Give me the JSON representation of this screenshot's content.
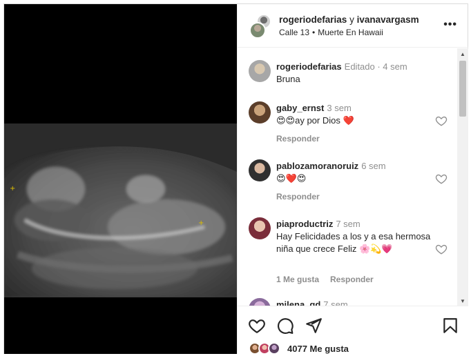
{
  "header": {
    "user1": "rogeriodefarias",
    "conj": "y",
    "user2": "ivanavargasm",
    "artist": "Calle 13",
    "song": "Muerte En Hawaii",
    "more": "•••"
  },
  "comments": [
    {
      "user": "rogeriodefarias",
      "meta": "Editado  ·  4 sem",
      "text": "Bruna",
      "reply": "",
      "likes": ""
    },
    {
      "user": "gaby_ernst",
      "meta": "3 sem",
      "text": "😍😍ay por Dios ❤️",
      "reply": "Responder",
      "likes": ""
    },
    {
      "user": "pablozamoranoruiz",
      "meta": "6 sem",
      "text": "😍❤️😍",
      "reply": "Responder",
      "likes": ""
    },
    {
      "user": "piaproductriz",
      "meta": "7 sem",
      "text": "Hay Felicidades a los y a esa hermosa niña que crece Feliz 🌸💫💗",
      "reply": "Responder",
      "likes": "1 Me gusta"
    },
    {
      "user": "milena_gd",
      "meta": "7 sem",
      "text": "",
      "reply": "",
      "likes": ""
    }
  ],
  "footer": {
    "likes": "4077 Me gusta"
  },
  "colors": {
    "text": "#262626",
    "muted": "#8e8e8e",
    "heart": "#ed4956",
    "border": "#dbdbdb"
  },
  "icons": [
    "more-icon",
    "heart-outline-icon",
    "comment-icon",
    "share-icon",
    "save-icon",
    "scroll-up-icon",
    "scroll-down-icon"
  ]
}
